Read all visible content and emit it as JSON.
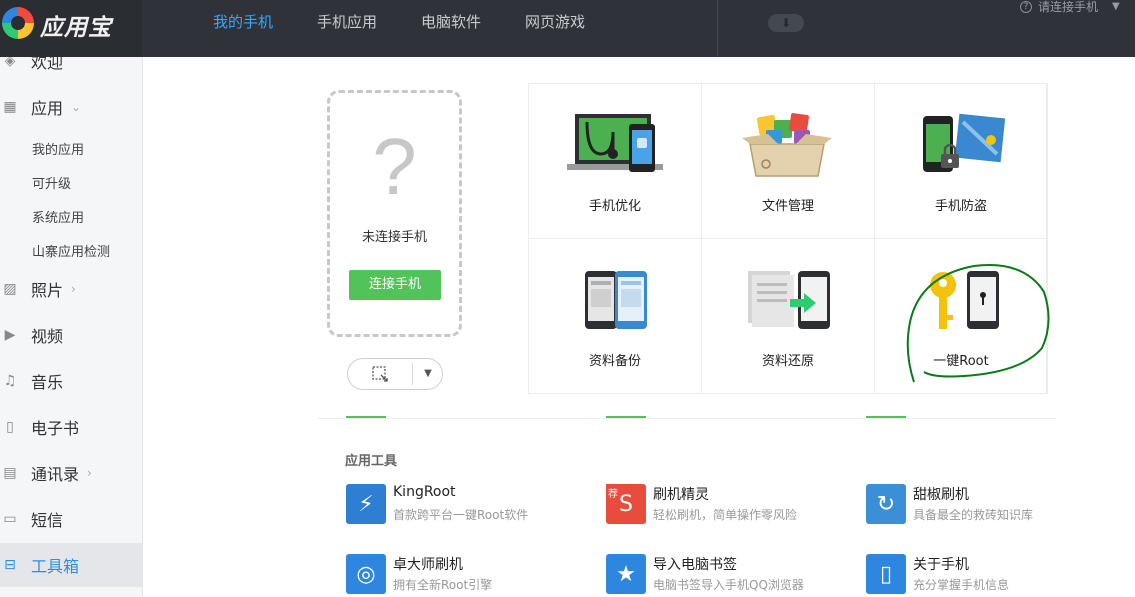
{
  "app": {
    "title": "应用宝"
  },
  "topnav": {
    "tabs": [
      "我的手机",
      "手机应用",
      "电脑软件",
      "网页游戏"
    ],
    "status": "请连接手机"
  },
  "sidebar": {
    "items": [
      {
        "label": "欢迎",
        "icon": "welcome-icon"
      },
      {
        "label": "应用",
        "icon": "grid-icon"
      },
      {
        "label": "照片",
        "icon": "photo-icon"
      },
      {
        "label": "视频",
        "icon": "video-icon"
      },
      {
        "label": "音乐",
        "icon": "music-icon"
      },
      {
        "label": "电子书",
        "icon": "book-icon"
      },
      {
        "label": "通讯录",
        "icon": "contacts-icon"
      },
      {
        "label": "短信",
        "icon": "sms-icon"
      },
      {
        "label": "工具箱",
        "icon": "toolbox-icon"
      }
    ],
    "sub_items": [
      "我的应用",
      "可升级",
      "系统应用",
      "山寨应用检测"
    ]
  },
  "phone_panel": {
    "status": "未连接手机",
    "connect_label": "连接手机",
    "placeholder_glyph": "?"
  },
  "features": [
    {
      "label": "手机优化"
    },
    {
      "label": "文件管理"
    },
    {
      "label": "手机防盗"
    },
    {
      "label": "资料备份"
    },
    {
      "label": "资料还原"
    },
    {
      "label": "一键Root"
    }
  ],
  "tools_section": {
    "title": "应用工具",
    "badge": "荐",
    "items": [
      {
        "name": "KingRoot",
        "desc": "首款跨平台一键Root软件",
        "color": "#2e7fd1"
      },
      {
        "name": "刷机精灵",
        "desc": "轻松刷机，简单操作零风险",
        "color": "#e74c3c"
      },
      {
        "name": "甜椒刷机",
        "desc": "具备最全的救砖知识库",
        "color": "#3a8fd6"
      },
      {
        "name": "卓大师刷机",
        "desc": "拥有全新Root引擎",
        "color": "#2e86de"
      },
      {
        "name": "导入电脑书签",
        "desc": "电脑书签导入手机QQ浏览器",
        "color": "#2e86de"
      },
      {
        "name": "关于手机",
        "desc": "充分掌握手机信息",
        "color": "#2e86de"
      }
    ]
  },
  "colors": {
    "accent": "#34a7ff",
    "green": "#52c35b",
    "topbar": "#2f3238",
    "annotation": "#0a7a1a"
  }
}
